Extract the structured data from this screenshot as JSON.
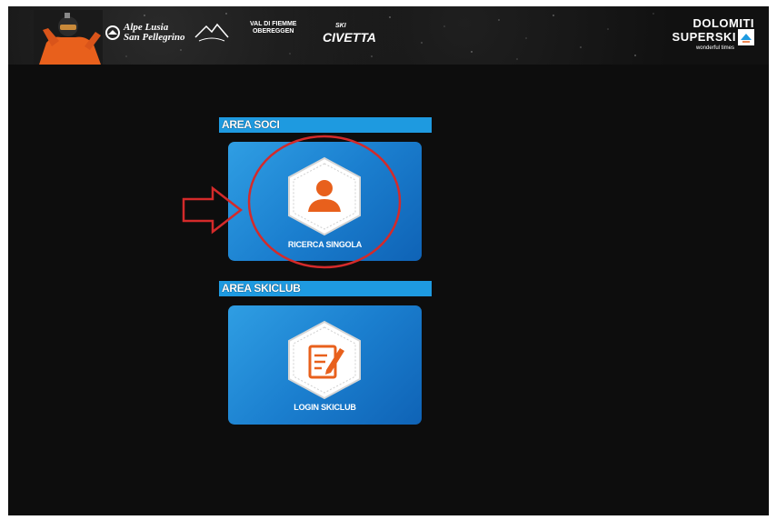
{
  "header": {
    "brands": {
      "alpe_lusia_line1": "Alpe Lusia",
      "alpe_lusia_line2": "San Pellegrino",
      "val_di_fiemme_line1": "VAL DI FIEMME",
      "val_di_fiemme_line2": "OBEREGGEN",
      "civetta_small": "SKI",
      "civetta": "CIVETTA"
    },
    "dolomiti": {
      "line1": "DOLOMITI",
      "line2": "SUPERSKI",
      "tagline": "wonderful times"
    }
  },
  "sections": {
    "soci": {
      "title": "AREA SOCI",
      "card_label": "RICERCA SINGOLA",
      "icon": "person-icon"
    },
    "skiclub": {
      "title": "AREA SKICLUB",
      "card_label": "LOGIN SKICLUB",
      "icon": "document-edit-icon"
    }
  },
  "colors": {
    "accent_blue": "#1e9ae0",
    "icon_orange": "#e8601c",
    "annotation_red": "#d42a2a",
    "background": "#0d0d0d"
  }
}
